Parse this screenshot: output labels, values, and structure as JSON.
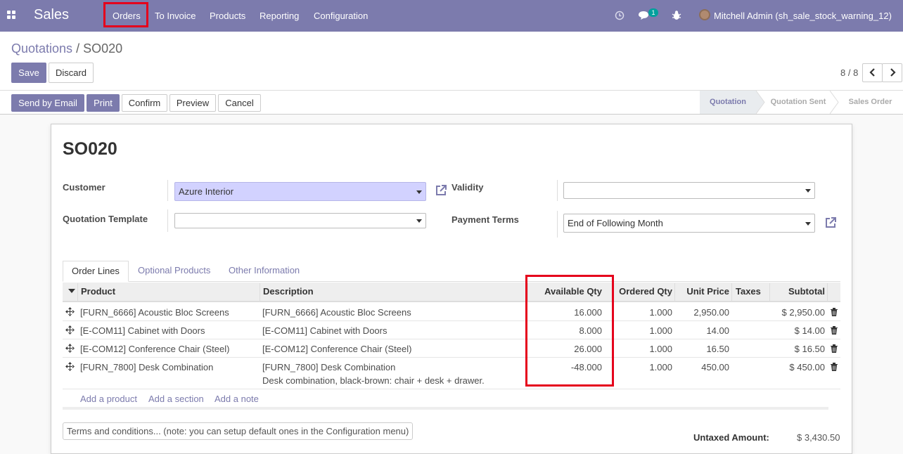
{
  "navbar": {
    "brand": "Sales",
    "menus": [
      "Orders",
      "To Invoice",
      "Products",
      "Reporting",
      "Configuration"
    ],
    "messages_count": "1",
    "user": "Mitchell Admin (sh_sale_stock_warning_12)"
  },
  "breadcrumb": {
    "parent": "Quotations",
    "separator": "/",
    "current": "SO020"
  },
  "buttons": {
    "save": "Save",
    "discard": "Discard"
  },
  "pager": "8 / 8",
  "actions": [
    "Send by Email",
    "Print",
    "Confirm",
    "Preview",
    "Cancel"
  ],
  "statusbar": [
    "Quotation",
    "Quotation Sent",
    "Sales Order"
  ],
  "form": {
    "title": "SO020",
    "customer_label": "Customer",
    "customer_value": "Azure Interior",
    "template_label": "Quotation Template",
    "template_value": "",
    "validity_label": "Validity",
    "validity_value": "",
    "payment_terms_label": "Payment Terms",
    "payment_terms_value": "End of Following Month"
  },
  "tabs": [
    "Order Lines",
    "Optional Products",
    "Other Information"
  ],
  "table": {
    "headers": [
      "Product",
      "Description",
      "Available Qty",
      "Ordered Qty",
      "Unit Price",
      "Taxes",
      "Subtotal"
    ],
    "rows": [
      {
        "product": "[FURN_6666] Acoustic Bloc Screens",
        "description": "[FURN_6666] Acoustic Bloc Screens",
        "description2": "",
        "available": "16.000",
        "ordered": "1.000",
        "price": "2,950.00",
        "subtotal": "$ 2,950.00"
      },
      {
        "product": "[E-COM11] Cabinet with Doors",
        "description": "[E-COM11] Cabinet with Doors",
        "description2": "",
        "available": "8.000",
        "ordered": "1.000",
        "price": "14.00",
        "subtotal": "$ 14.00"
      },
      {
        "product": "[E-COM12] Conference Chair (Steel)",
        "description": "[E-COM12] Conference Chair (Steel)",
        "description2": "",
        "available": "26.000",
        "ordered": "1.000",
        "price": "16.50",
        "subtotal": "$ 16.50"
      },
      {
        "product": "[FURN_7800] Desk Combination",
        "description": "[FURN_7800] Desk Combination",
        "description2": "Desk combination, black-brown: chair + desk + drawer.",
        "available": "-48.000",
        "ordered": "1.000",
        "price": "450.00",
        "subtotal": "$ 450.00"
      }
    ],
    "add_links": [
      "Add a product",
      "Add a section",
      "Add a note"
    ]
  },
  "footer": {
    "terms_placeholder": "Terms and conditions... (note: you can setup default ones in the Configuration menu)",
    "untaxed_label": "Untaxed Amount:",
    "untaxed_value": "$ 3,430.50"
  },
  "colors": {
    "brand": "#7c7bad",
    "highlight": "#e5001c",
    "required": "#d2d2ff"
  }
}
